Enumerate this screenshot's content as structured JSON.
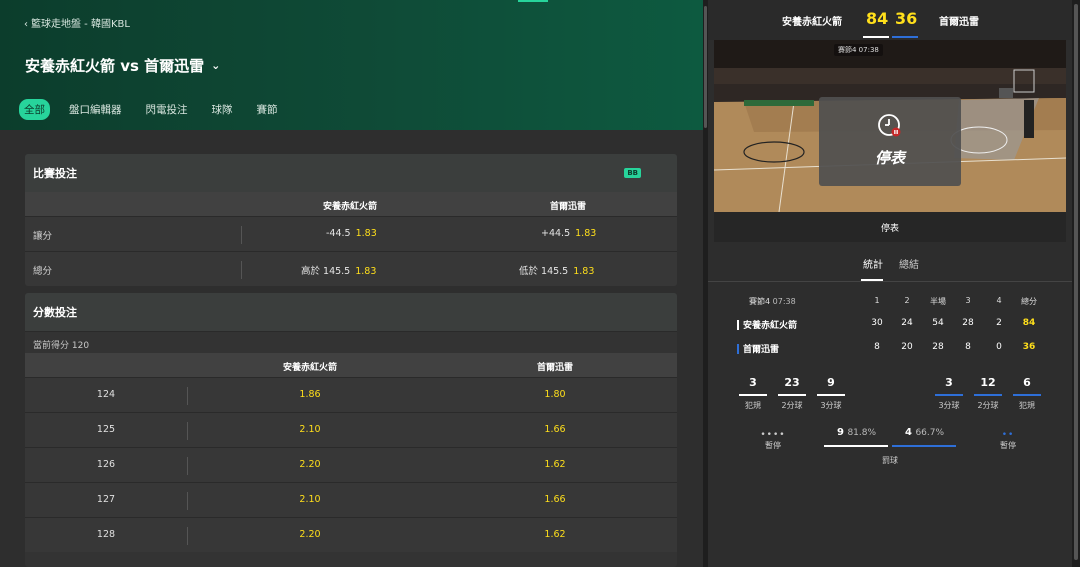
{
  "breadcrumb": "籃球走地盤 - 韓國KBL",
  "match_title": "安養赤紅火箭 vs 首爾迅雷",
  "tabs": [
    "全部",
    "盤口編輯器",
    "閃電投注",
    "球隊",
    "賽節"
  ],
  "game_bet": {
    "title": "比賽投注",
    "badge": "BB",
    "team1": "安養赤紅火箭",
    "team2": "首爾迅雷",
    "rows": [
      {
        "label": "讓分",
        "h1": "-44.5",
        "o1": "1.83",
        "h2": "+44.5",
        "o2": "1.83"
      },
      {
        "label": "總分",
        "h1": "高於 145.5",
        "o1": "1.83",
        "h2": "低於 145.5",
        "o2": "1.83"
      }
    ]
  },
  "score_bet": {
    "title": "分數投注",
    "current": "當前得分 120",
    "team1": "安養赤紅火箭",
    "team2": "首爾迅雷",
    "rows": [
      {
        "score": "124",
        "o1": "1.86",
        "o2": "1.80"
      },
      {
        "score": "125",
        "o1": "2.10",
        "o2": "1.66"
      },
      {
        "score": "126",
        "o1": "2.20",
        "o2": "1.62"
      },
      {
        "score": "127",
        "o1": "2.10",
        "o2": "1.66"
      },
      {
        "score": "128",
        "o1": "2.20",
        "o2": "1.62"
      }
    ]
  },
  "scoreboard": {
    "team1": "安養赤紅火箭",
    "team2": "首爾迅雷",
    "score1": "84",
    "score2": "36"
  },
  "video": {
    "period_tag": "賽節4 07:38",
    "overlay_text": "停表",
    "status_bar": "停表"
  },
  "right_tabs": [
    "統計",
    "總結"
  ],
  "stats_table": {
    "period_label": "賽節4",
    "clock": "07:38",
    "headers": [
      "1",
      "2",
      "半場",
      "3",
      "4",
      "總分"
    ],
    "rows": [
      {
        "team": "安養赤紅火箭",
        "q": [
          "30",
          "24",
          "54",
          "28",
          "2"
        ],
        "total": "84"
      },
      {
        "team": "首爾迅雷",
        "q": [
          "8",
          "20",
          "28",
          "8",
          "0"
        ],
        "total": "36"
      }
    ]
  },
  "team_stats": {
    "left": [
      {
        "value": "3",
        "label": "犯規"
      },
      {
        "value": "23",
        "label": "2分球"
      },
      {
        "value": "9",
        "label": "3分球"
      }
    ],
    "right": [
      {
        "value": "3",
        "label": "3分球"
      },
      {
        "value": "12",
        "label": "2分球"
      },
      {
        "value": "6",
        "label": "犯規"
      }
    ],
    "timeouts_label": "暫停",
    "freethrow_label": "罰球",
    "ft1": "9",
    "ft1_pct": "81.8%",
    "ft2": "4",
    "ft2_pct": "66.7%",
    "timeout_left_dots": "••••",
    "timeout_right_dots": "••"
  },
  "colors": {
    "accent": "#27d49b",
    "odds": "#ffdf1b",
    "team1": "#ffffff",
    "team2": "#2e6fd8"
  }
}
